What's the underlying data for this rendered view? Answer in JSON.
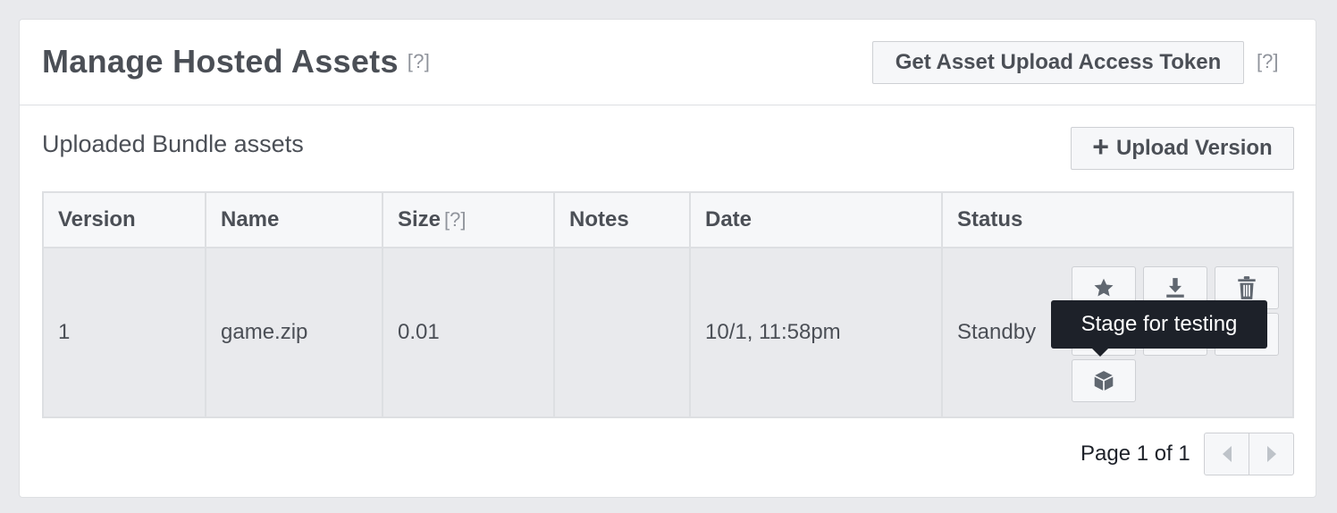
{
  "header": {
    "title": "Manage Hosted Assets",
    "title_help": "[?]",
    "token_button": "Get Asset Upload Access Token",
    "token_help": "[?]"
  },
  "section": {
    "title": "Uploaded Bundle assets",
    "upload_button": "Upload Version",
    "upload_icon": "plus-icon"
  },
  "table": {
    "columns": [
      "Version",
      "Name",
      "Size",
      "Notes",
      "Date",
      "Status"
    ],
    "size_help": "[?]",
    "rows": [
      {
        "version": "1",
        "name": "game.zip",
        "size": "0.01",
        "notes": "",
        "date": "10/1, 11:58pm",
        "status": "Standby"
      }
    ],
    "row_actions": [
      "star-icon",
      "download-icon",
      "trash-icon",
      "hidden-action",
      "hidden-action",
      "link-icon",
      "box-icon"
    ]
  },
  "tooltip": {
    "text": "Stage for testing"
  },
  "pagination": {
    "text": "Page 1 of 1",
    "prev_icon": "chevron-left-icon",
    "next_icon": "chevron-right-icon"
  },
  "colors": {
    "background": "#e9eaed",
    "panel": "#ffffff",
    "text": "#4b4f56",
    "muted": "#90949c",
    "tooltip": "#1d2129",
    "icon": "#606770"
  }
}
